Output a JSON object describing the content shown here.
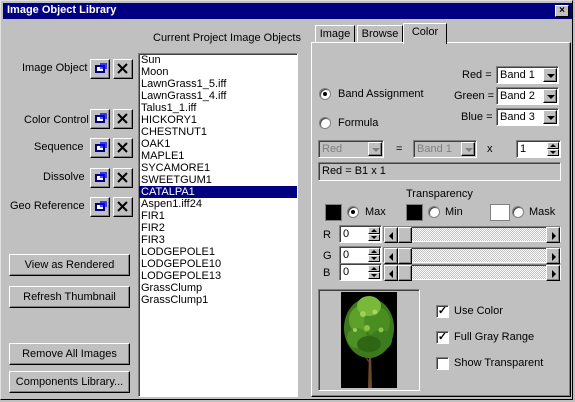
{
  "window": {
    "title": "Image Object Library"
  },
  "left": {
    "rows": [
      {
        "label": "Image Object"
      },
      {
        "label": "Color Control"
      },
      {
        "label": "Sequence"
      },
      {
        "label": "Dissolve"
      },
      {
        "label": "Geo Reference"
      }
    ],
    "view_as_rendered": "View as Rendered",
    "refresh_thumbnail": "Refresh Thumbnail",
    "remove_all_images": "Remove All Images",
    "components_library": "Components Library..."
  },
  "list": {
    "header": "Current Project Image Objects",
    "items": [
      "Sun",
      "Moon",
      "LawnGrass1_5.iff",
      "LawnGrass1_4.iff",
      "Talus1_1.iff",
      "HICKORY1",
      "CHESTNUT1",
      "OAK1",
      "MAPLE1",
      "SYCAMORE1",
      "SWEETGUM1",
      "CATALPA1",
      "Aspen1.iff24",
      "FIR1",
      "FIR2",
      "FIR3",
      "LODGEPOLE1",
      "LODGEPOLE10",
      "LODGEPOLE13",
      "GrassClump",
      "GrassClump1"
    ],
    "selected": "CATALPA1"
  },
  "tabs": [
    {
      "label": "Image"
    },
    {
      "label": "Browse"
    },
    {
      "label": "Color",
      "active": true
    }
  ],
  "color": {
    "band_assignment": "Band Assignment",
    "formula": "Formula",
    "red_label": "Red =",
    "green_label": "Green =",
    "blue_label": "Blue =",
    "red_value": "Band 1",
    "green_value": "Band 2",
    "blue_value": "Band 3",
    "formula_channel": "Red",
    "equals": "=",
    "formula_band": "Band 1",
    "times": "x",
    "multiplier": "1",
    "formula_text": "Red = B1 x 1",
    "transparency_label": "Transparency",
    "max_label": "Max",
    "min_label": "Min",
    "mask_label": "Mask",
    "r_label": "R",
    "g_label": "G",
    "b_label": "B",
    "r_value": "0",
    "g_value": "0",
    "b_value": "0",
    "use_color": "Use Color",
    "full_gray_range": "Full Gray Range",
    "show_transparent": "Show Transparent",
    "use_color_checked": true,
    "full_gray_range_checked": true,
    "show_transparent_checked": false,
    "colors": {
      "max": "#000000",
      "min": "#000000",
      "mask": "#ffffff"
    }
  }
}
